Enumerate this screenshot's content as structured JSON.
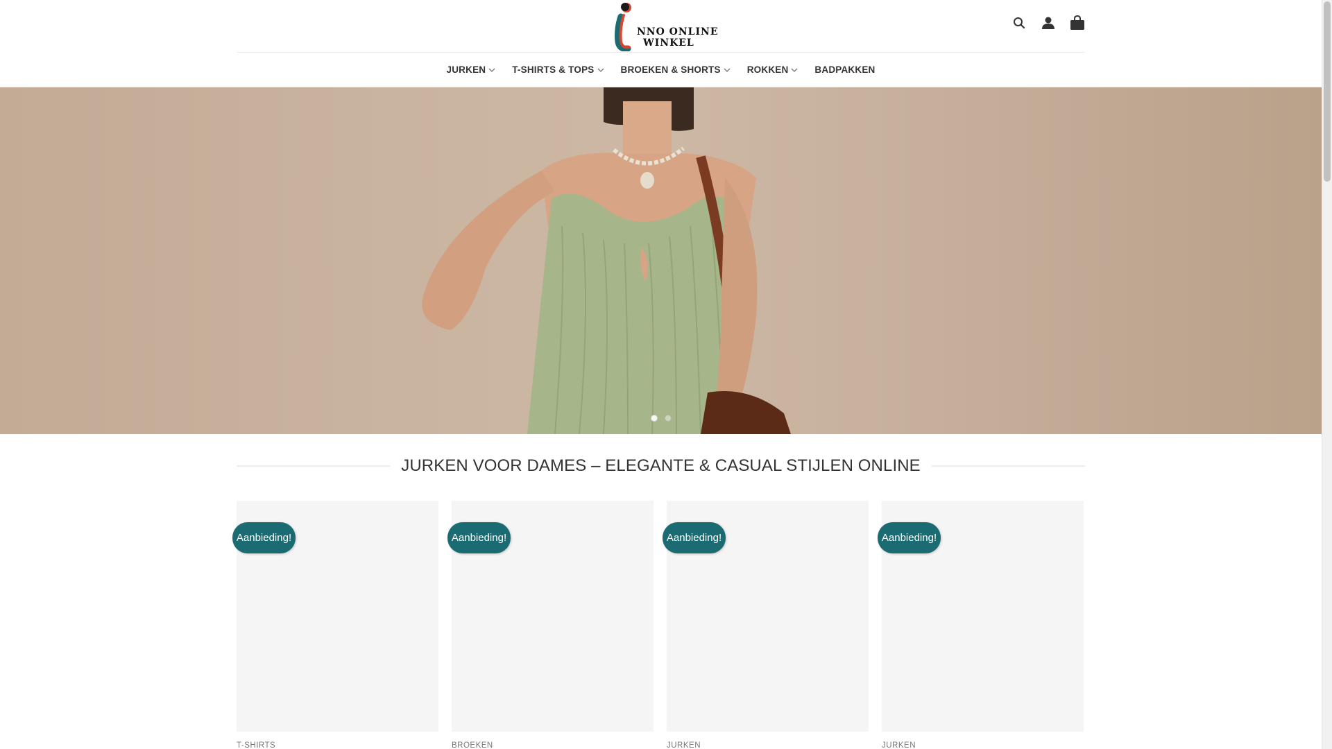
{
  "logo": {
    "line1": "NNO ONLINE",
    "line2": "WINKEL",
    "alt": "Inno Online Winkel"
  },
  "header": {
    "icons": [
      "search-icon",
      "account-icon",
      "cart-icon"
    ]
  },
  "nav": {
    "items": [
      {
        "label": "JURKEN",
        "has_dropdown": true
      },
      {
        "label": "T-SHIRTS & TOPS",
        "has_dropdown": true
      },
      {
        "label": "BROEKEN & SHORTS",
        "has_dropdown": true
      },
      {
        "label": "ROKKEN",
        "has_dropdown": true
      },
      {
        "label": "BADPAKKEN",
        "has_dropdown": false
      }
    ]
  },
  "hero": {
    "slides": 2,
    "active_slide": 1
  },
  "section": {
    "title": "JURKEN VOOR DAMES – ELEGANTE & CASUAL STIJLEN ONLINE"
  },
  "products": [
    {
      "badge": "Aanbieding!",
      "category": "T-SHIRTS"
    },
    {
      "badge": "Aanbieding!",
      "category": "BROEKEN"
    },
    {
      "badge": "Aanbieding!",
      "category": "JURKEN"
    },
    {
      "badge": "Aanbieding!",
      "category": "JURKEN"
    }
  ],
  "colors": {
    "badge": "#1a6b72",
    "nav_text": "#333333",
    "hero_bg": "#c9b4a0",
    "dress": "#a7b58a"
  }
}
